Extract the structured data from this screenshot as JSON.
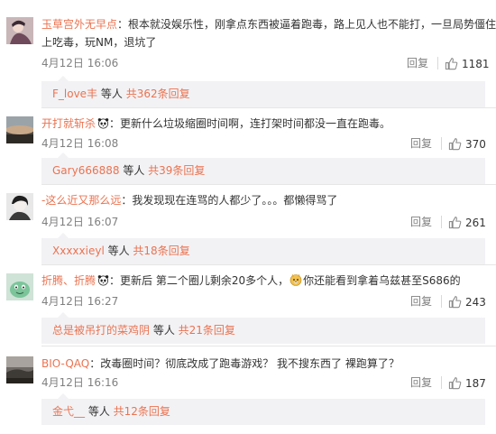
{
  "labels": {
    "reply": "回复",
    "others": " 等人 "
  },
  "colors": {
    "username": "#eb7350",
    "muted": "#808080",
    "reply_bg": "#f2f2f5"
  },
  "comments": [
    {
      "username": "玉草宫外无早点",
      "text_line1": "：根本就没娱乐性，刚拿点东西被逼着跑毒，路上见人也不能打，一旦局势僵住马",
      "text_line2": "上吃毒，玩NM，退坑了",
      "time": "4月12日 16:06",
      "likes": "1181",
      "reply_user": "F_love丰",
      "reply_count": "共362条回复"
    },
    {
      "username": "开打就斩杀",
      "text_line1": "：更新什么垃圾缩圈时间啊，连打架时间都没一直在跑毒。",
      "time": "4月12日 16:08",
      "likes": "370",
      "reply_user": "Gary666888",
      "reply_count": "共39条回复"
    },
    {
      "username": "-这么近又那么远",
      "text_line1": "：我发现现在连骂的人都少了。。。都懒得骂了",
      "time": "4月12日 16:07",
      "likes": "261",
      "reply_user": "Xxxxxieyl",
      "reply_count": "共18条回复"
    },
    {
      "username": "折腾、折腾",
      "text_line1_a": "：更新后 第二个圈儿剩余20多个人，",
      "text_line1_b": "你还能看到拿着乌兹甚至S686的",
      "time": "4月12日 16:27",
      "likes": "243",
      "reply_user": "总是被吊打的菜鸡阴",
      "reply_count": "共21条回复"
    },
    {
      "username": "BIO-QAQ",
      "text_line1": "：改毒圈时间？彻底改成了跑毒游戏？  我不搜东西了  裸跑算了？",
      "time": "4月12日 16:16",
      "likes": "187",
      "reply_user": "金弋__",
      "reply_count": "共12条回复"
    }
  ]
}
